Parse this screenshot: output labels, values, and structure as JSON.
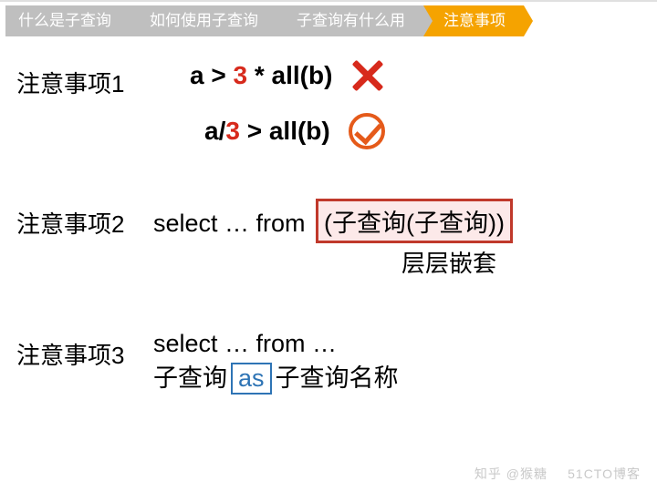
{
  "tabs": {
    "t1": "什么是子查询",
    "t2": "如何使用子查询",
    "t3": "子查询有什么用",
    "t4": "注意事项"
  },
  "section1": {
    "label": "注意事项1",
    "wrong_a": "a > ",
    "wrong_num": "3",
    "wrong_b": " * all(b)",
    "right_a": "a/",
    "right_num": "3",
    "right_b": " > all(b)"
  },
  "section2": {
    "label": "注意事项2",
    "prefix": "select … from ",
    "boxed": "(子查询(子查询))",
    "caption": "层层嵌套"
  },
  "section3": {
    "label": "注意事项3",
    "line1": "select … from …",
    "line2a": "子查询",
    "kw": "as",
    "line2b": "子查询名称"
  },
  "watermark1": "知乎 @猴糖",
  "watermark2": "51CTO博客"
}
